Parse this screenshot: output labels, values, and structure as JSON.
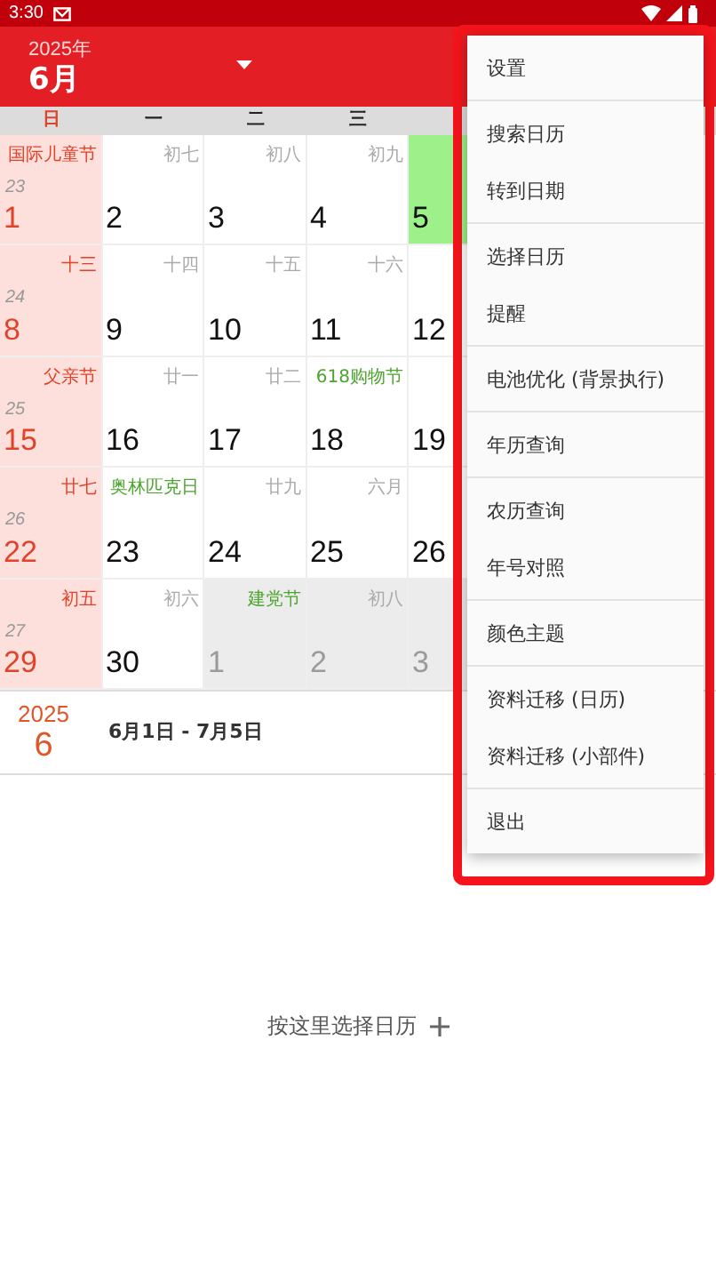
{
  "status_bar": {
    "time": "3:30"
  },
  "header": {
    "year": "2025年",
    "month": "6月"
  },
  "weekdays": [
    {
      "label": "日",
      "sunday": true
    },
    {
      "label": "一",
      "sunday": false
    },
    {
      "label": "二",
      "sunday": false
    },
    {
      "label": "三",
      "sunday": false
    }
  ],
  "weeks": [
    {
      "week": "23",
      "days": [
        {
          "lunar": "国际儿童节",
          "day": "1",
          "other_month": false,
          "today": false
        },
        {
          "lunar": "初七",
          "festival": false,
          "day": "2",
          "other_month": false,
          "today": false
        },
        {
          "lunar": "初八",
          "festival": false,
          "day": "3",
          "other_month": false,
          "today": false
        },
        {
          "lunar": "初九",
          "festival": false,
          "day": "4",
          "other_month": false,
          "today": false
        },
        {
          "day": "5",
          "other_month": false,
          "today": true
        }
      ]
    },
    {
      "week": "24",
      "days": [
        {
          "lunar": "十三",
          "day": "8",
          "other_month": false,
          "today": false
        },
        {
          "lunar": "十四",
          "festival": false,
          "day": "9",
          "other_month": false,
          "today": false
        },
        {
          "lunar": "十五",
          "festival": false,
          "day": "10",
          "other_month": false,
          "today": false
        },
        {
          "lunar": "十六",
          "festival": false,
          "day": "11",
          "other_month": false,
          "today": false
        },
        {
          "day": "12",
          "other_month": false,
          "today": false
        }
      ]
    },
    {
      "week": "25",
      "days": [
        {
          "lunar": "父亲节",
          "day": "15",
          "other_month": false,
          "today": false
        },
        {
          "lunar": "廿一",
          "festival": false,
          "day": "16",
          "other_month": false,
          "today": false
        },
        {
          "lunar": "廿二",
          "festival": false,
          "day": "17",
          "other_month": false,
          "today": false
        },
        {
          "lunar": "618购物节",
          "festival": true,
          "day": "18",
          "other_month": false,
          "today": false
        },
        {
          "day": "19",
          "other_month": false,
          "today": false
        }
      ]
    },
    {
      "week": "26",
      "days": [
        {
          "lunar": "廿七",
          "day": "22",
          "other_month": false,
          "today": false
        },
        {
          "lunar": "奥林匹克日",
          "festival": true,
          "day": "23",
          "other_month": false,
          "today": false
        },
        {
          "lunar": "廿九",
          "festival": false,
          "day": "24",
          "other_month": false,
          "today": false
        },
        {
          "lunar": "六月",
          "festival": false,
          "day": "25",
          "other_month": false,
          "today": false
        },
        {
          "day": "26",
          "other_month": false,
          "today": false
        }
      ]
    },
    {
      "week": "27",
      "days": [
        {
          "lunar": "初五",
          "day": "29",
          "other_month": false,
          "today": false
        },
        {
          "lunar": "初六",
          "festival": false,
          "day": "30",
          "other_month": false,
          "today": false
        },
        {
          "lunar": "建党节",
          "festival": true,
          "day": "1",
          "other_month": true,
          "today": false
        },
        {
          "lunar": "初八",
          "festival": false,
          "day": "2",
          "other_month": true,
          "today": false
        },
        {
          "day": "3",
          "other_month": true,
          "today": false
        }
      ]
    }
  ],
  "summary": {
    "year": "2025",
    "month": "6",
    "range": "6月1日 - 7月5日"
  },
  "select_calendar": {
    "label": "按这里选择日历"
  },
  "menu": [
    [
      "设置"
    ],
    [
      "搜索日历",
      "转到日期"
    ],
    [
      "选择日历",
      "提醒"
    ],
    [
      "电池优化 (背景执行)"
    ],
    [
      "年历查询"
    ],
    [
      "农历查询",
      "年号对照"
    ],
    [
      "颜色主题"
    ],
    [
      "资料迁移 (日历)",
      "资料迁移 (小部件)"
    ],
    [
      "退出"
    ]
  ]
}
